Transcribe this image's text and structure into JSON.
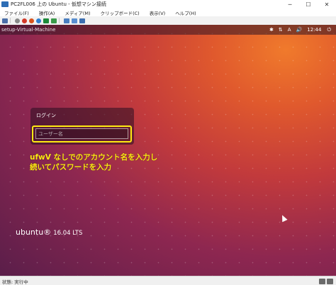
{
  "window": {
    "title": "PC2FL006 上の Ubuntu - 仮想マシン接続",
    "minimize_glyph": "─",
    "maximize_glyph": "☐",
    "close_glyph": "✕"
  },
  "menu": [
    "ファイル(F)",
    "操作(A)",
    "メディア(M)",
    "クリップボード(C)",
    "表示(V)",
    "ヘルプ(H)"
  ],
  "toolbar": {
    "icons": [
      "ctrl-alt-del-icon",
      "start-icon",
      "turnoff-icon",
      "shutdown-icon",
      "save-icon",
      "pause-icon",
      "reset-icon",
      "checkpoint-icon",
      "revert-icon",
      "enhanced-session-icon"
    ]
  },
  "vm": {
    "hostname": "setup-Virtual-Machine",
    "clock": "12:44",
    "indicators": {
      "accessibility": "✱",
      "network": "⇅",
      "keyboard": "A",
      "volume": "🔊",
      "power": "⏻"
    },
    "login": {
      "title": "ログイン",
      "username_placeholder": "ユーザー名"
    },
    "annotation_line1": "ufwV なしでのアカウント名を入力し",
    "annotation_line2": "続いてパスワードを入力",
    "brand": "ubuntu®",
    "version": "16.04 LTS"
  },
  "status": {
    "text": "状態: 実行中"
  },
  "colors": {
    "highlight": "#ffeb12",
    "wallpaper_top": "#e0592d",
    "wallpaper_bottom": "#5a1e4a"
  }
}
